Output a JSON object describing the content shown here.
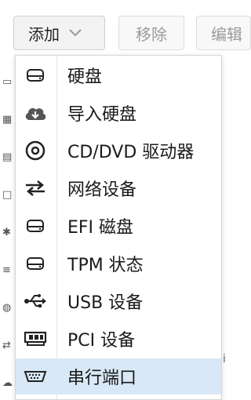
{
  "toolbar": {
    "add_label": "添加",
    "remove_label": "移除",
    "edit_label": "编辑"
  },
  "menu": {
    "items": [
      {
        "label": "硬盘",
        "icon": "hard-disk-icon"
      },
      {
        "label": "导入硬盘",
        "icon": "cloud-download-icon"
      },
      {
        "label": "CD/DVD 驱动器",
        "icon": "cd-dvd-icon"
      },
      {
        "label": "网络设备",
        "icon": "exchange-arrows-icon"
      },
      {
        "label": "EFI 磁盘",
        "icon": "hard-disk-icon"
      },
      {
        "label": "TPM 状态",
        "icon": "hard-disk-icon"
      },
      {
        "label": "USB 设备",
        "icon": "usb-icon"
      },
      {
        "label": "PCI 设备",
        "icon": "pci-card-icon"
      },
      {
        "label": "串行端口",
        "icon": "serial-port-icon"
      }
    ],
    "active_index": 8,
    "active_color": "#d9e8f6"
  }
}
